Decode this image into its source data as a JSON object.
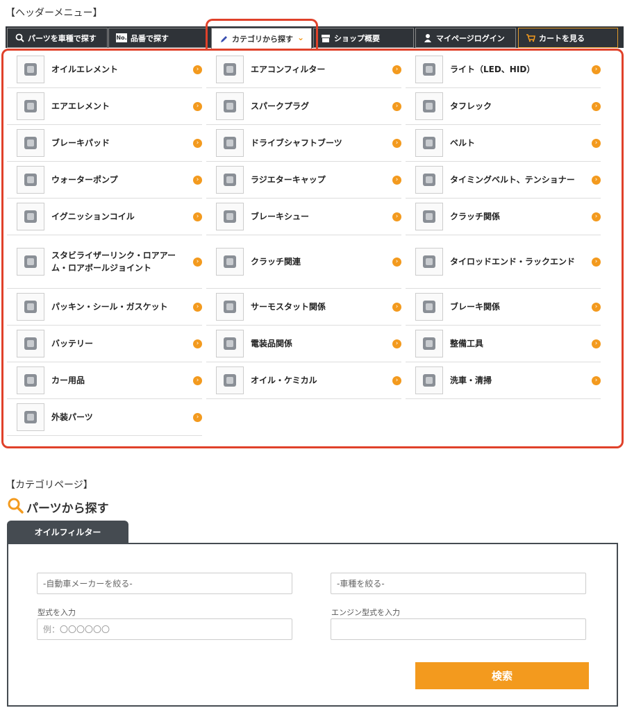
{
  "header_menu_label": "【ヘッダーメニュー】",
  "nav": {
    "tabs": [
      {
        "label": "パーツを車種で探す",
        "icon": "search-icon"
      },
      {
        "label": "品番で探す",
        "icon": "number-icon"
      },
      {
        "label": "カテゴリから探す",
        "icon": "pen-icon"
      },
      {
        "label": "ショップ概要",
        "icon": "shop-icon"
      },
      {
        "label": "マイページログイン",
        "icon": "person-icon"
      },
      {
        "label": "カートを見る",
        "icon": "cart-icon"
      }
    ],
    "number_icon_text": "No.",
    "chevron": "⌄"
  },
  "menu": {
    "columns": [
      [
        {
          "label": "オイルエレメント",
          "icon": "oil-element-image"
        },
        {
          "label": "エアエレメント",
          "icon": "air-element-image"
        },
        {
          "label": "ブレーキパッド",
          "icon": "brake-pad-image"
        },
        {
          "label": "ウォーターポンプ",
          "icon": "water-pump-image"
        },
        {
          "label": "イグニッションコイル",
          "icon": "ignition-coil-image"
        },
        {
          "label": "スタビライザーリンク・ロアアーム・ロアボールジョイント",
          "icon": "stabilizer-link-image"
        },
        {
          "label": "パッキン・シール・ガスケット",
          "icon": "gasket-image"
        },
        {
          "label": "バッテリー",
          "icon": "battery-image"
        },
        {
          "label": "カー用品",
          "icon": "car-goods-image"
        },
        {
          "label": "外装パーツ",
          "icon": "exterior-parts-image"
        }
      ],
      [
        {
          "label": "エアコンフィルター",
          "icon": "ac-filter-image"
        },
        {
          "label": "スパークプラグ",
          "icon": "spark-plug-image"
        },
        {
          "label": "ドライブシャフトブーツ",
          "icon": "drive-shaft-boot-image"
        },
        {
          "label": "ラジエターキャップ",
          "icon": "radiator-cap-image"
        },
        {
          "label": "ブレーキシュー",
          "icon": "brake-shoe-image"
        },
        {
          "label": "クラッチ関連",
          "icon": "clutch-related-image"
        },
        {
          "label": "サーモスタット関係",
          "icon": "thermostat-image"
        },
        {
          "label": "電装品関係",
          "icon": "electrical-image"
        },
        {
          "label": "オイル・ケミカル",
          "icon": "oil-chemical-image"
        }
      ],
      [
        {
          "label": "ライト（LED、HID）",
          "icon": "light-bulb-image"
        },
        {
          "label": "タフレック",
          "icon": "tuffrek-image"
        },
        {
          "label": "ベルト",
          "icon": "belt-image"
        },
        {
          "label": "タイミングベルト、テンショナー",
          "icon": "timing-belt-image"
        },
        {
          "label": "クラッチ関係",
          "icon": "clutch-image"
        },
        {
          "label": "タイロッドエンド・ラックエンド",
          "icon": "tie-rod-image"
        },
        {
          "label": "ブレーキ関係",
          "icon": "brake-disc-image"
        },
        {
          "label": "整備工具",
          "icon": "tools-image"
        },
        {
          "label": "洗車・清掃",
          "icon": "car-wash-image"
        }
      ]
    ],
    "arrow": "›"
  },
  "category_page_label": "【カテゴリページ】",
  "search": {
    "title": "パーツから探す",
    "tab_label": "オイルフィルター",
    "maker_placeholder": "-自動車メーカーを絞る-",
    "model_placeholder": "-車種を絞る-",
    "type_label": "型式を入力",
    "type_placeholder": "例：〇〇〇〇〇〇",
    "engine_label": "エンジン型式を入力",
    "engine_placeholder": "",
    "button_label": "検索"
  },
  "colors": {
    "accent_orange": "#f39a1e",
    "highlight_red": "#e0412a",
    "nav_dark": "#2f3338"
  }
}
